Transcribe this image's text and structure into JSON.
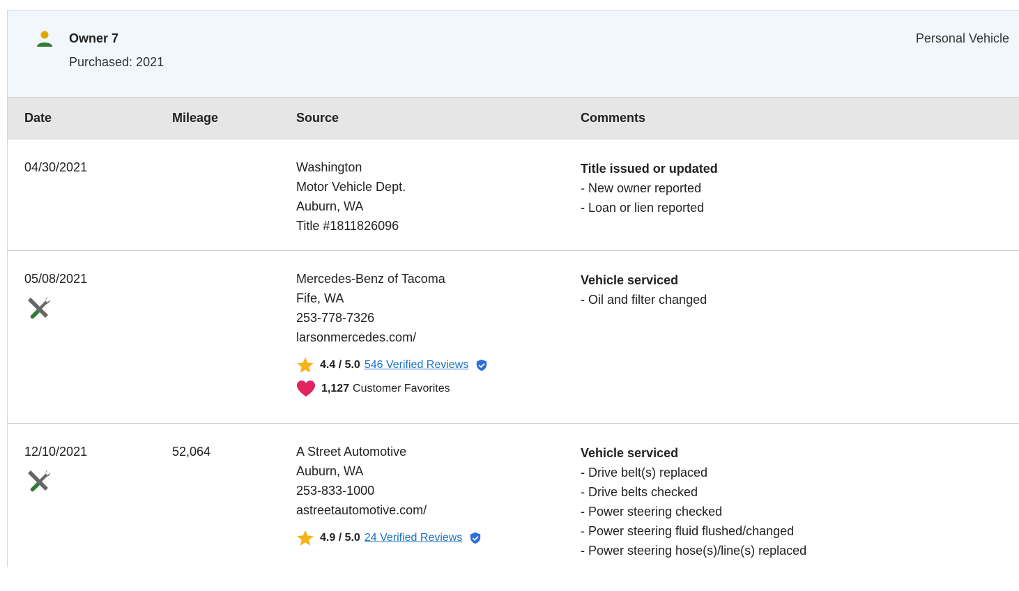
{
  "owner": {
    "name": "Owner 7",
    "purchased": "Purchased: 2021",
    "type": "Personal Vehicle"
  },
  "table": {
    "headers": [
      "Date",
      "Mileage",
      "Source",
      "Comments"
    ]
  },
  "records": [
    {
      "date": "04/30/2021",
      "mileage": "",
      "source": [
        "Washington",
        "Motor Vehicle Dept.",
        "Auburn, WA",
        "Title #1811826096"
      ],
      "comment_title": "Title issued or updated",
      "comments": [
        "- New owner reported",
        "- Loan or lien reported"
      ]
    },
    {
      "date": "05/08/2021",
      "mileage": "",
      "source": [
        "Mercedes-Benz of Tacoma",
        "Fife, WA",
        "253-778-7326",
        "larsonmercedes.com/"
      ],
      "rating": "4.4 / 5.0",
      "reviews": "546 Verified Reviews",
      "favorites_count": "1,127",
      "favorites_label": "Customer Favorites",
      "comment_title": "Vehicle serviced",
      "comments": [
        "- Oil and filter changed"
      ]
    },
    {
      "date": "12/10/2021",
      "mileage": "52,064",
      "source": [
        "A Street Automotive",
        "Auburn, WA",
        "253-833-1000",
        "astreetautomotive.com/"
      ],
      "rating": "4.9 / 5.0",
      "reviews": "24 Verified Reviews",
      "comment_title": "Vehicle serviced",
      "comments": [
        "- Drive belt(s) replaced",
        "- Drive belts checked",
        "- Power steering checked",
        "- Power steering fluid flushed/changed",
        "- Power steering hose(s)/line(s) replaced"
      ]
    }
  ],
  "colors": {
    "accent_link": "#1a73c9",
    "owner_icon": "#2e7d32",
    "owner_head": "#e0a800",
    "star": "#f6b21b",
    "heart": "#e0245e",
    "verified": "#2f6fd8",
    "header_bg": "#f1f7fc"
  }
}
